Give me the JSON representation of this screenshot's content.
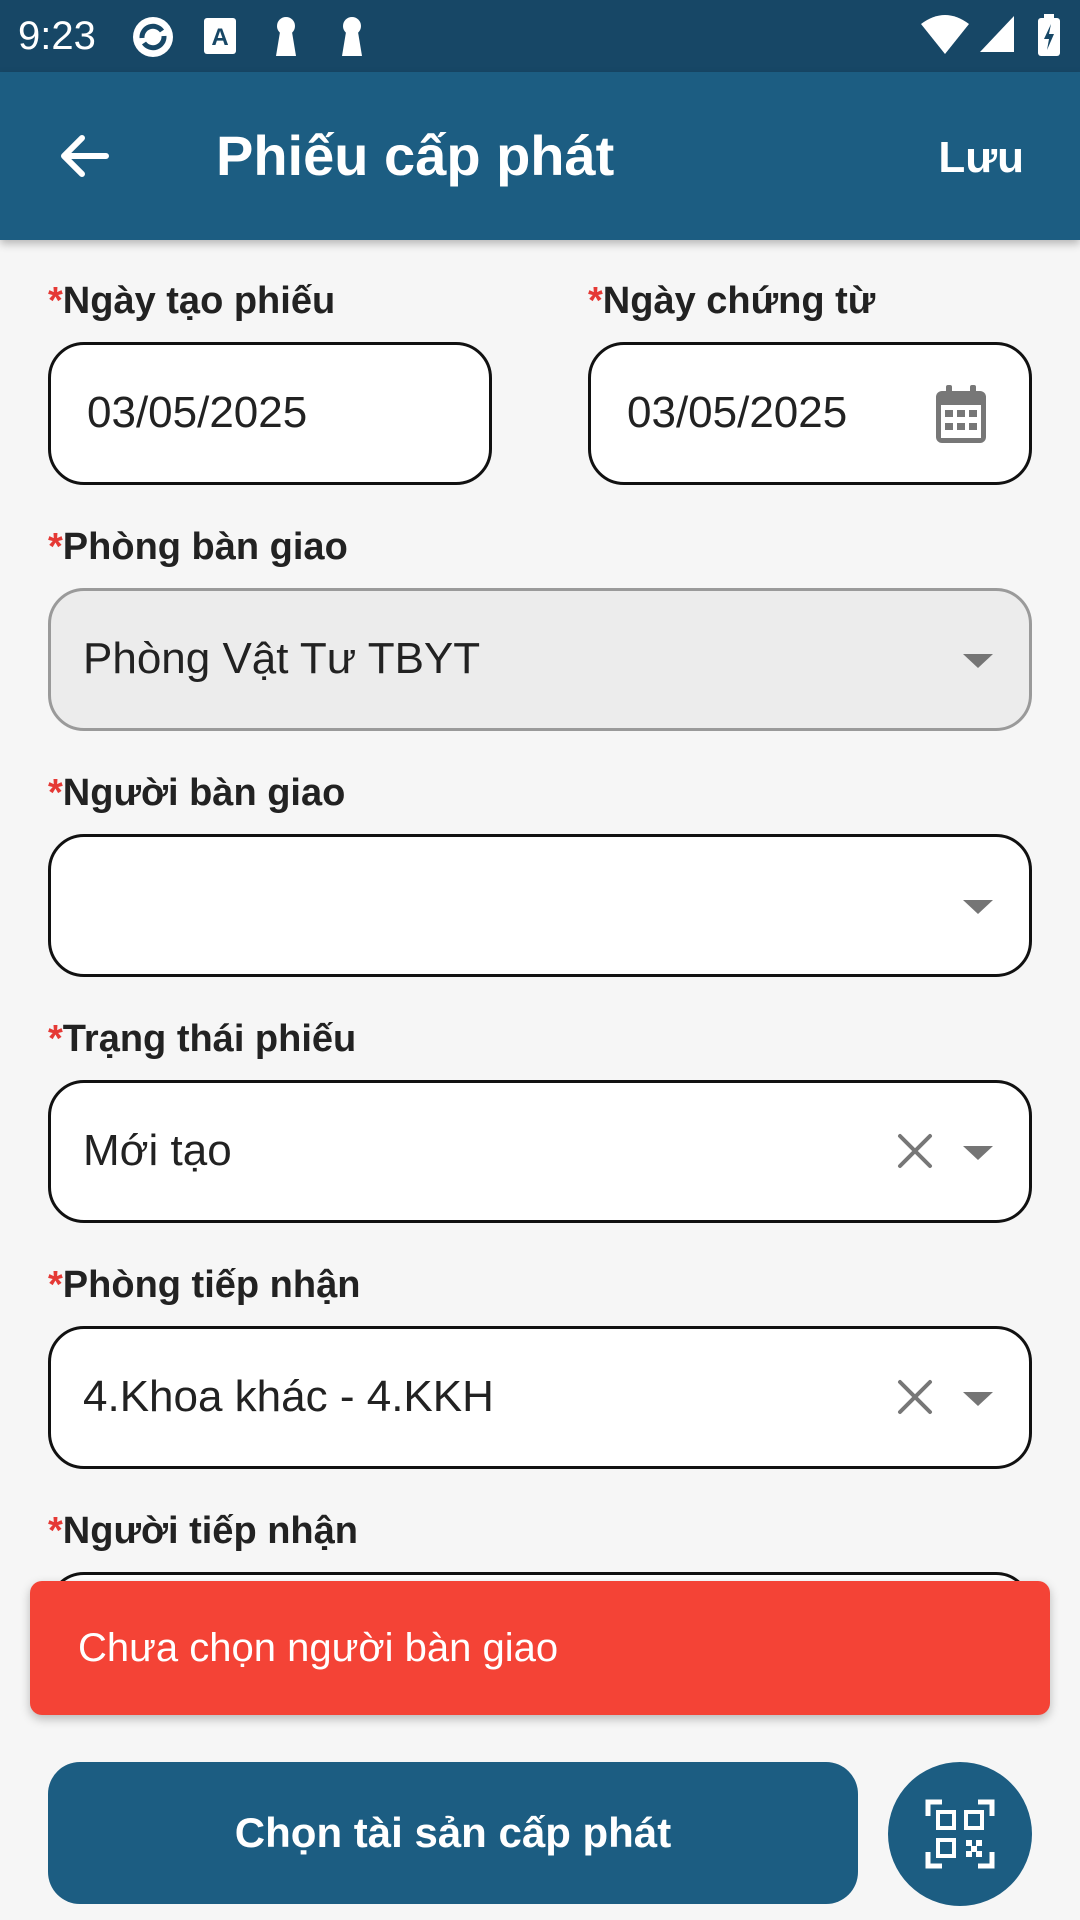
{
  "status_bar": {
    "time": "9:23",
    "icons": [
      "sync-icon",
      "font-a-icon",
      "keyhole-icon",
      "keyhole-icon",
      "wifi-icon",
      "signal-icon",
      "battery-charging-icon"
    ]
  },
  "app_bar": {
    "title": "Phiếu cấp phát",
    "save_label": "Lưu",
    "back_icon": "arrow-left-icon"
  },
  "form": {
    "required_mark": "*",
    "ngay_tao_phieu": {
      "label": "Ngày tạo phiếu",
      "value": "03/05/2025"
    },
    "ngay_chung_tu": {
      "label": "Ngày chứng từ",
      "value": "03/05/2025",
      "icon": "calendar-icon"
    },
    "phong_ban_giao": {
      "label": "Phòng bàn giao",
      "value": "Phòng Vật Tư TBYT",
      "disabled": true
    },
    "nguoi_ban_giao": {
      "label": "Người bàn giao",
      "value": ""
    },
    "trang_thai_phieu": {
      "label": "Trạng thái phiếu",
      "value": "Mới tạo"
    },
    "phong_tiep_nhan": {
      "label": "Phòng tiếp nhận",
      "value": "4.Khoa khác - 4.KKH"
    },
    "nguoi_tiep_nhan": {
      "label": "Người tiếp nhận",
      "value": ""
    }
  },
  "snackbar": {
    "message": "Chưa chọn người bàn giao"
  },
  "actions": {
    "select_assets_label": "Chọn tài sản cấp phát",
    "qr_icon": "qr-code-scan-icon"
  },
  "colors": {
    "status_bar": "#174766",
    "app_bar": "#1c5d82",
    "primary_button": "#1c5d82",
    "error": "#f44336",
    "required": "#e53935"
  }
}
